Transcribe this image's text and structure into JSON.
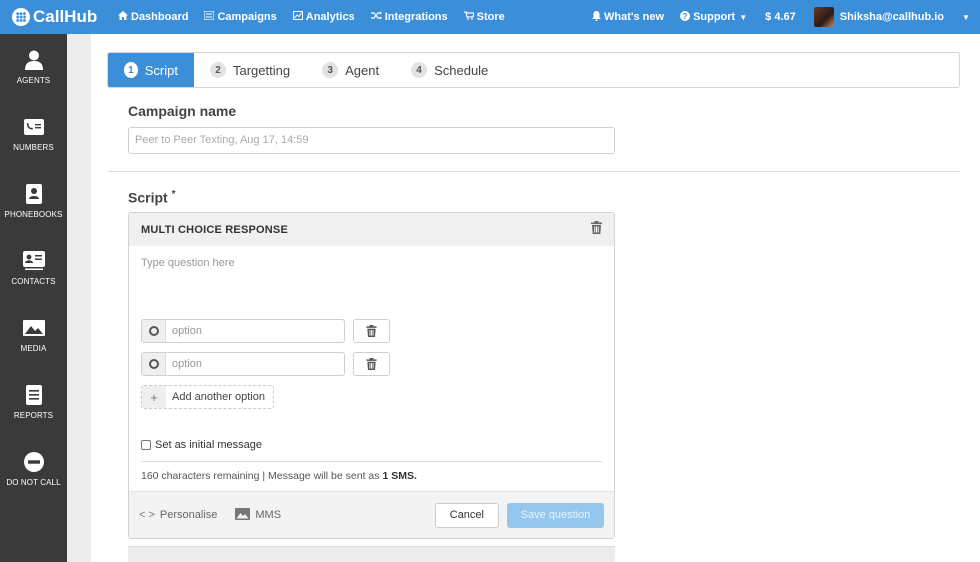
{
  "brand": {
    "name": "CallHub"
  },
  "nav": [
    {
      "label": "Dashboard",
      "icon": "home-icon"
    },
    {
      "label": "Campaigns",
      "icon": "list-icon"
    },
    {
      "label": "Analytics",
      "icon": "chart-icon"
    },
    {
      "label": "Integrations",
      "icon": "shuffle-icon"
    },
    {
      "label": "Store",
      "icon": "cart-icon"
    }
  ],
  "nav_right": {
    "whats_new": "What's new",
    "support": "Support",
    "balance": "$ 4.67",
    "user_email": "Shiksha@callhub.io"
  },
  "sidebar": [
    {
      "label": "AGENTS",
      "icon": "person-icon"
    },
    {
      "label": "NUMBERS",
      "icon": "phone-card-icon"
    },
    {
      "label": "PHONEBOOKS",
      "icon": "phonebook-icon"
    },
    {
      "label": "CONTACTS",
      "icon": "contact-card-icon"
    },
    {
      "label": "MEDIA",
      "icon": "image-icon"
    },
    {
      "label": "REPORTS",
      "icon": "report-icon"
    },
    {
      "label": "DO NOT CALL",
      "icon": "block-icon"
    }
  ],
  "steps": [
    {
      "num": "1",
      "label": "Script",
      "active": true
    },
    {
      "num": "2",
      "label": "Targetting",
      "active": false
    },
    {
      "num": "3",
      "label": "Agent",
      "active": false
    },
    {
      "num": "4",
      "label": "Schedule",
      "active": false
    }
  ],
  "campaign": {
    "label": "Campaign name",
    "placeholder": "Peer to Peer Texting, Aug 17, 14:59"
  },
  "script": {
    "label": "Script",
    "required_mark": "*",
    "question": {
      "type_title": "MULTI CHOICE RESPONSE",
      "placeholder": "Type question here",
      "options": [
        {
          "placeholder": "option"
        },
        {
          "placeholder": "option"
        }
      ],
      "add_option_label": "Add another option",
      "initial_message_label": "Set as initial message",
      "chars_text": "160 characters remaining | Message will be sent as ",
      "sms_count": "1 SMS.",
      "personalise_label": "Personalise",
      "mms_label": "MMS",
      "cancel_label": "Cancel",
      "save_label": "Save question"
    }
  },
  "colors": {
    "topbar": "#3b8fd9",
    "sidebar": "#3a3a3a",
    "save_disabled": "#94c6ee"
  }
}
